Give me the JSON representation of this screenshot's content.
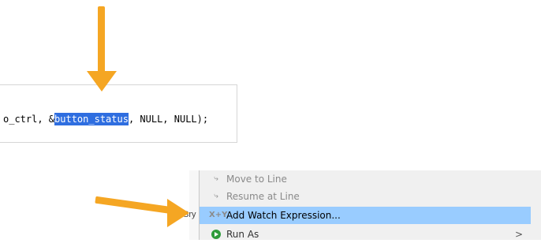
{
  "editor": {
    "code_before": "o_ctrl, &",
    "code_selected": "button_status",
    "code_after": ", NULL, NULL);"
  },
  "menu": {
    "items": [
      {
        "label": "Move to Line",
        "icon": "move-to-line-icon",
        "enabled": false
      },
      {
        "label": "Resume at Line",
        "icon": "resume-at-line-icon",
        "enabled": false
      },
      {
        "label": "Add Watch Expression...",
        "icon": "watch-expression-icon",
        "enabled": true,
        "highlighted": true
      },
      {
        "label": "Run As",
        "icon": "run-icon",
        "enabled": true,
        "submenu": ">"
      }
    ],
    "edge_peek": "Sry"
  },
  "colors": {
    "annotation_arrow": "#f5a623",
    "selection": "#2f6ee0",
    "menu_highlight": "#99ccff"
  }
}
